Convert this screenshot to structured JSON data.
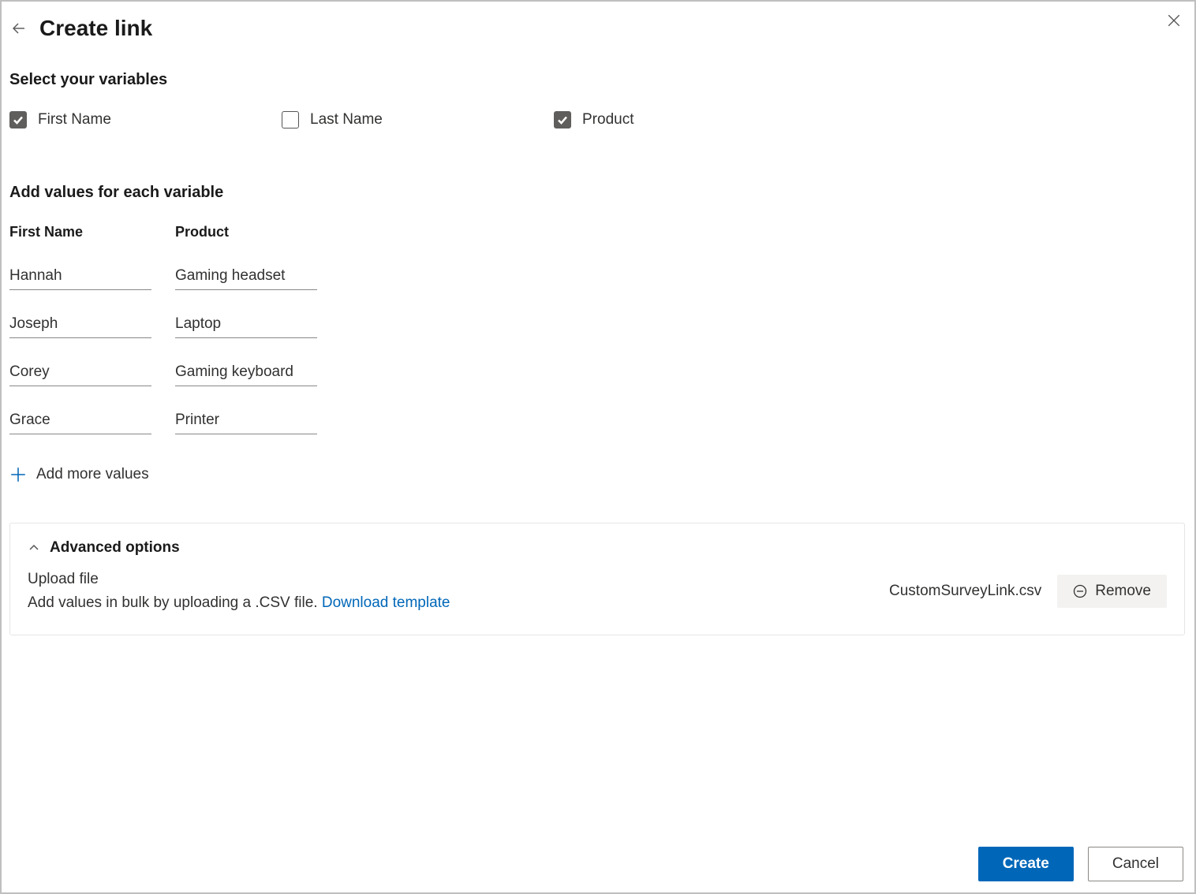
{
  "header": {
    "title": "Create link"
  },
  "variables": {
    "heading": "Select your variables",
    "items": [
      {
        "label": "First Name",
        "checked": true
      },
      {
        "label": "Last Name",
        "checked": false
      },
      {
        "label": "Product",
        "checked": true
      }
    ]
  },
  "values": {
    "heading": "Add values for each variable",
    "columns": [
      "First Name",
      "Product"
    ],
    "rows": [
      {
        "first_name": "Hannah",
        "product": "Gaming headset"
      },
      {
        "first_name": "Joseph",
        "product": "Laptop"
      },
      {
        "first_name": "Corey",
        "product": "Gaming keyboard"
      },
      {
        "first_name": "Grace",
        "product": "Printer"
      }
    ],
    "add_more_label": "Add more values"
  },
  "advanced": {
    "title": "Advanced options",
    "upload_label": "Upload file",
    "upload_description": "Add values in bulk by uploading a .CSV file. ",
    "download_link": "Download template",
    "filename": "CustomSurveyLink.csv",
    "remove_label": "Remove"
  },
  "footer": {
    "create_label": "Create",
    "cancel_label": "Cancel"
  }
}
